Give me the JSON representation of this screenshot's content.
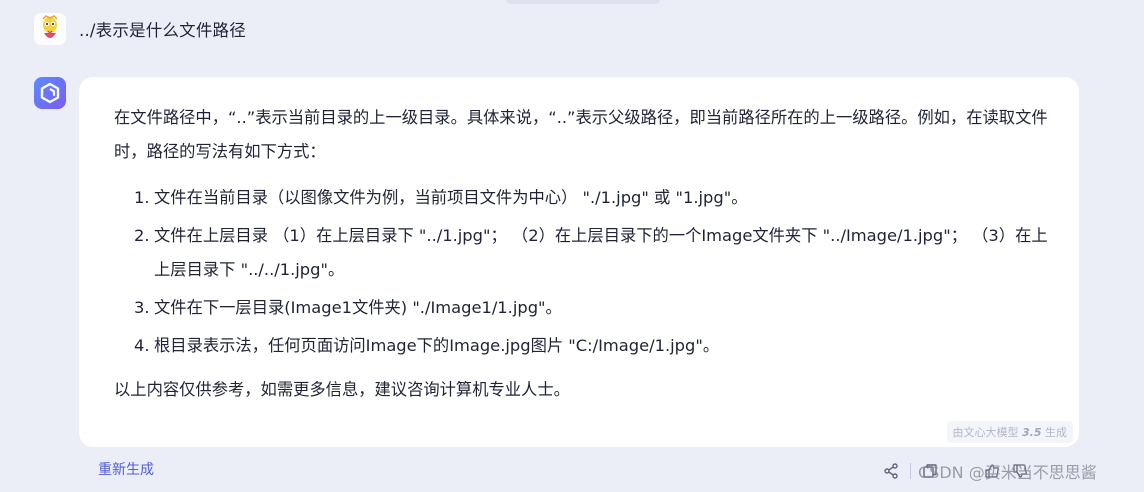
{
  "user_message": {
    "text": "../表示是什么文件路径"
  },
  "answer": {
    "intro": "在文件路径中，“..”表示当前目录的上一级目录。具体来说，“..”表示父级路径，即当前路径所在的上一级路径。例如，在读取文件时，路径的写法有如下方式：",
    "items": [
      {
        "num": "1.",
        "text": "文件在当前目录（以图像文件为例，当前项目文件为中心） \"./1.jpg\" 或 \"1.jpg\"。"
      },
      {
        "num": "2.",
        "text": "文件在上层目录 （1）在上层目录下 \"../1.jpg\"； （2）在上层目录下的一个Image文件夹下 \"../Image/1.jpg\"； （3）在上上层目录下 \"../../1.jpg\"。"
      },
      {
        "num": "3.",
        "text": "文件在下一层目录(Image1文件夹) \"./Image1/1.jpg\"。"
      },
      {
        "num": "4.",
        "text": "根目录表示法，任何页面访问Image下的Image.jpg图片 \"C:/Image/1.jpg\"。"
      }
    ],
    "outro": "以上内容仅供参考，如需更多信息，建议咨询计算机专业人士。",
    "badge_prefix": "由文心大模型",
    "badge_version": "3.5",
    "badge_suffix": "生成"
  },
  "actions": {
    "regenerate_label": "重新生成",
    "icons": [
      "share-icon",
      "copy-icon",
      "thumbs-up-icon",
      "thumbs-down-icon"
    ]
  },
  "watermark": "CSDN @买米当不思思酱",
  "colors": {
    "page_bg": "#eceef7",
    "card_bg": "#ffffff",
    "accent": "#4f5ed4"
  }
}
